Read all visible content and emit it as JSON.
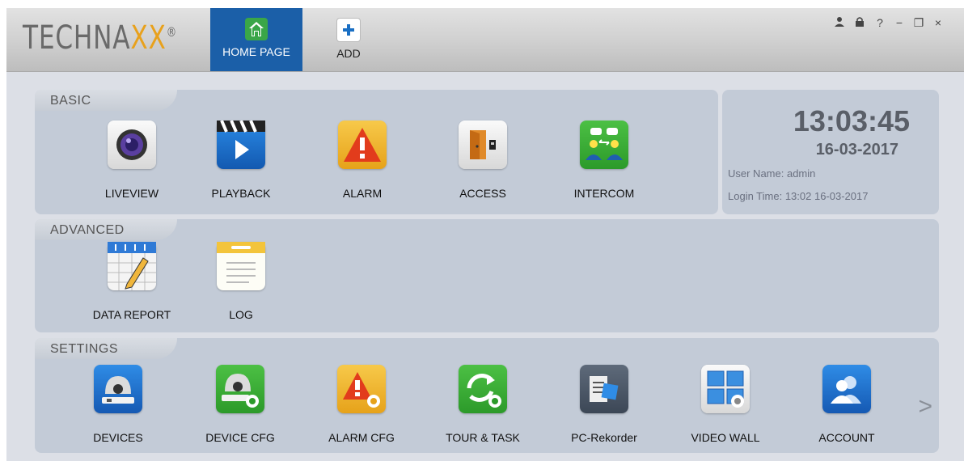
{
  "app": {
    "logo_text": "TECHNA",
    "logo_accent": "XX",
    "logo_reg": "®"
  },
  "tabs": [
    {
      "label": "HOME PAGE",
      "icon": "home-icon",
      "active": true
    },
    {
      "label": "ADD",
      "icon": "plus-icon",
      "active": false
    }
  ],
  "window_controls": [
    "user-icon",
    "lock-icon",
    "help-icon",
    "minimize-icon",
    "restore-icon",
    "close-icon"
  ],
  "window_control_glyphs": {
    "help": "?",
    "minimize": "−",
    "restore": "❐",
    "close": "×"
  },
  "sections": {
    "basic": {
      "title": "BASIC",
      "items": [
        {
          "label": "LIVEVIEW",
          "icon": "camera-lens-icon"
        },
        {
          "label": "PLAYBACK",
          "icon": "clapperboard-play-icon"
        },
        {
          "label": "ALARM",
          "icon": "alarm-warning-icon"
        },
        {
          "label": "ACCESS",
          "icon": "door-access-icon"
        },
        {
          "label": "INTERCOM",
          "icon": "intercom-users-icon"
        }
      ]
    },
    "advanced": {
      "title": "ADVANCED",
      "items": [
        {
          "label": "DATA REPORT",
          "icon": "spreadsheet-pencil-icon"
        },
        {
          "label": "LOG",
          "icon": "notepad-icon"
        }
      ]
    },
    "settings": {
      "title": "SETTINGS",
      "items": [
        {
          "label": "DEVICES",
          "icon": "dome-camera-icon"
        },
        {
          "label": "DEVICE CFG",
          "icon": "dome-camera-gear-icon"
        },
        {
          "label": "ALARM CFG",
          "icon": "alarm-gear-icon"
        },
        {
          "label": "TOUR & TASK",
          "icon": "refresh-gear-icon"
        },
        {
          "label": "PC-Rekorder",
          "icon": "recorder-icon"
        },
        {
          "label": "VIDEO WALL",
          "icon": "video-wall-gear-icon"
        },
        {
          "label": "ACCOUNT",
          "icon": "users-account-icon"
        }
      ],
      "next_glyph": ">"
    }
  },
  "clock": {
    "time": "13:03:45",
    "date": "16-03-2017",
    "user_line": "User Name: admin",
    "login_line": "Login Time:  13:02 16-03-2017"
  },
  "colors": {
    "active_tab": "#1b5fa8",
    "logo_accent": "#e8a11c",
    "panel_bg": "#c3cbd7"
  }
}
